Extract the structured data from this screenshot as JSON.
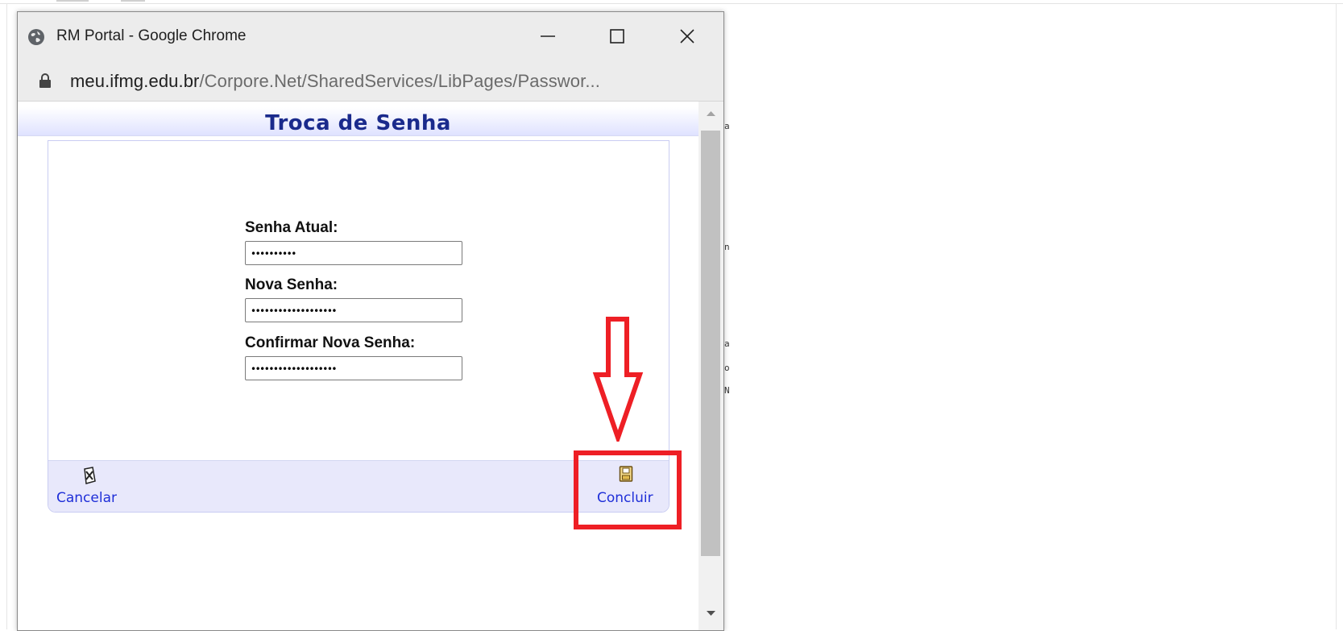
{
  "window": {
    "title": "RM Portal - Google Chrome",
    "url_host": "meu.ifmg.edu.br",
    "url_path": "/Corpore.Net/SharedServices/LibPages/Passwor..."
  },
  "page": {
    "header_title": "Troca de Senha",
    "fields": [
      {
        "label": "Senha Atual:",
        "value": "••••••••••"
      },
      {
        "label": "Nova Senha:",
        "value": "•••••••••••••••••••"
      },
      {
        "label": "Confirmar Nova Senha:",
        "value": "•••••••••••••••••••"
      }
    ],
    "cancel_label": "Cancelar",
    "confirm_label": "Concluir"
  },
  "background_chars": [
    "a",
    "n",
    "a",
    "o",
    "N"
  ],
  "colors": {
    "header_text": "#1a2a8c",
    "link": "#1f2fd8",
    "annotation": "#ee1f25",
    "footer_bg": "#e8e8fb"
  },
  "icons": [
    "globe-icon",
    "minimize-icon",
    "maximize-icon",
    "close-icon",
    "lock-icon",
    "cancel-icon",
    "save-icon",
    "scroll-up-icon",
    "scroll-down-icon",
    "annotation-arrow-icon"
  ]
}
